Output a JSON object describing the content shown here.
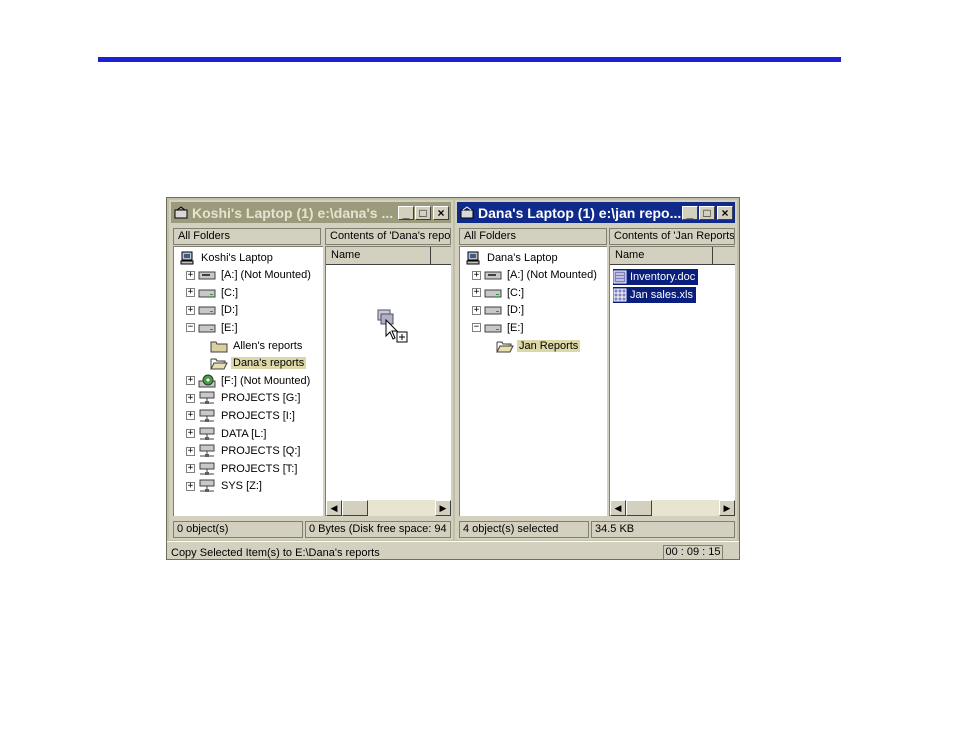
{
  "left_window": {
    "title": "Koshi's Laptop (1) e:\\dana's ...",
    "all_folders_header": "All Folders",
    "contents_header": "Contents of 'Dana's reports'",
    "name_column": "Name",
    "tree": [
      {
        "label": "Koshi's Laptop",
        "icon": "computer-icon",
        "expander": ""
      },
      {
        "label": "[A:] (Not Mounted)",
        "icon": "floppy-drive-icon",
        "expander": "+"
      },
      {
        "label": "[C:]",
        "icon": "drive-icon",
        "expander": "+"
      },
      {
        "label": "[D:]",
        "icon": "drive-icon",
        "expander": "+"
      },
      {
        "label": "[E:]",
        "icon": "drive-icon",
        "expander": "−"
      },
      {
        "label": "Allen's reports",
        "icon": "folder-icon",
        "expander": ""
      },
      {
        "label": "Dana's reports",
        "icon": "open-folder-icon",
        "expander": ""
      },
      {
        "label": "[F:] (Not Mounted)",
        "icon": "cdrom-icon",
        "expander": "+"
      },
      {
        "label": "PROJECTS [G:]",
        "icon": "network-drive-icon",
        "expander": "+"
      },
      {
        "label": "PROJECTS [I:]",
        "icon": "network-drive-icon",
        "expander": "+"
      },
      {
        "label": "DATA [L:]",
        "icon": "network-drive-icon",
        "expander": "+"
      },
      {
        "label": "PROJECTS [Q:]",
        "icon": "network-drive-icon",
        "expander": "+"
      },
      {
        "label": "PROJECTS [T:]",
        "icon": "network-drive-icon",
        "expander": "+"
      },
      {
        "label": "SYS [Z:]",
        "icon": "network-drive-icon",
        "expander": "+"
      }
    ],
    "status_left": "0 object(s)",
    "status_right": "0 Bytes (Disk free space: 94"
  },
  "right_window": {
    "title": "Dana's Laptop (1) e:\\jan repo...",
    "all_folders_header": "All Folders",
    "contents_header": "Contents of 'Jan Reports'",
    "name_column": "Name",
    "tree": [
      {
        "label": "Dana's Laptop",
        "icon": "computer-icon",
        "expander": ""
      },
      {
        "label": "[A:] (Not Mounted)",
        "icon": "floppy-drive-icon",
        "expander": "+"
      },
      {
        "label": "[C:]",
        "icon": "drive-icon",
        "expander": "+"
      },
      {
        "label": "[D:]",
        "icon": "drive-icon",
        "expander": "+"
      },
      {
        "label": "[E:]",
        "icon": "drive-icon",
        "expander": "−"
      },
      {
        "label": "Jan Reports",
        "icon": "open-folder-icon",
        "expander": ""
      }
    ],
    "files": [
      {
        "name": "Inventory.doc",
        "icon": "document-icon"
      },
      {
        "name": "Jan sales.xls",
        "icon": "spreadsheet-icon"
      }
    ],
    "status_left": "4 object(s) selected",
    "status_right": "34.5 KB"
  },
  "bottom": {
    "message": "Copy Selected Item(s) to E:\\Dana's reports",
    "timer": "00 : 09 : 15"
  },
  "colors": {
    "accent_line": "#1b1fd6",
    "active_title": "#0f2a8a",
    "inactive_title": "#9c9a7c",
    "selection": "#0a1f7d"
  }
}
